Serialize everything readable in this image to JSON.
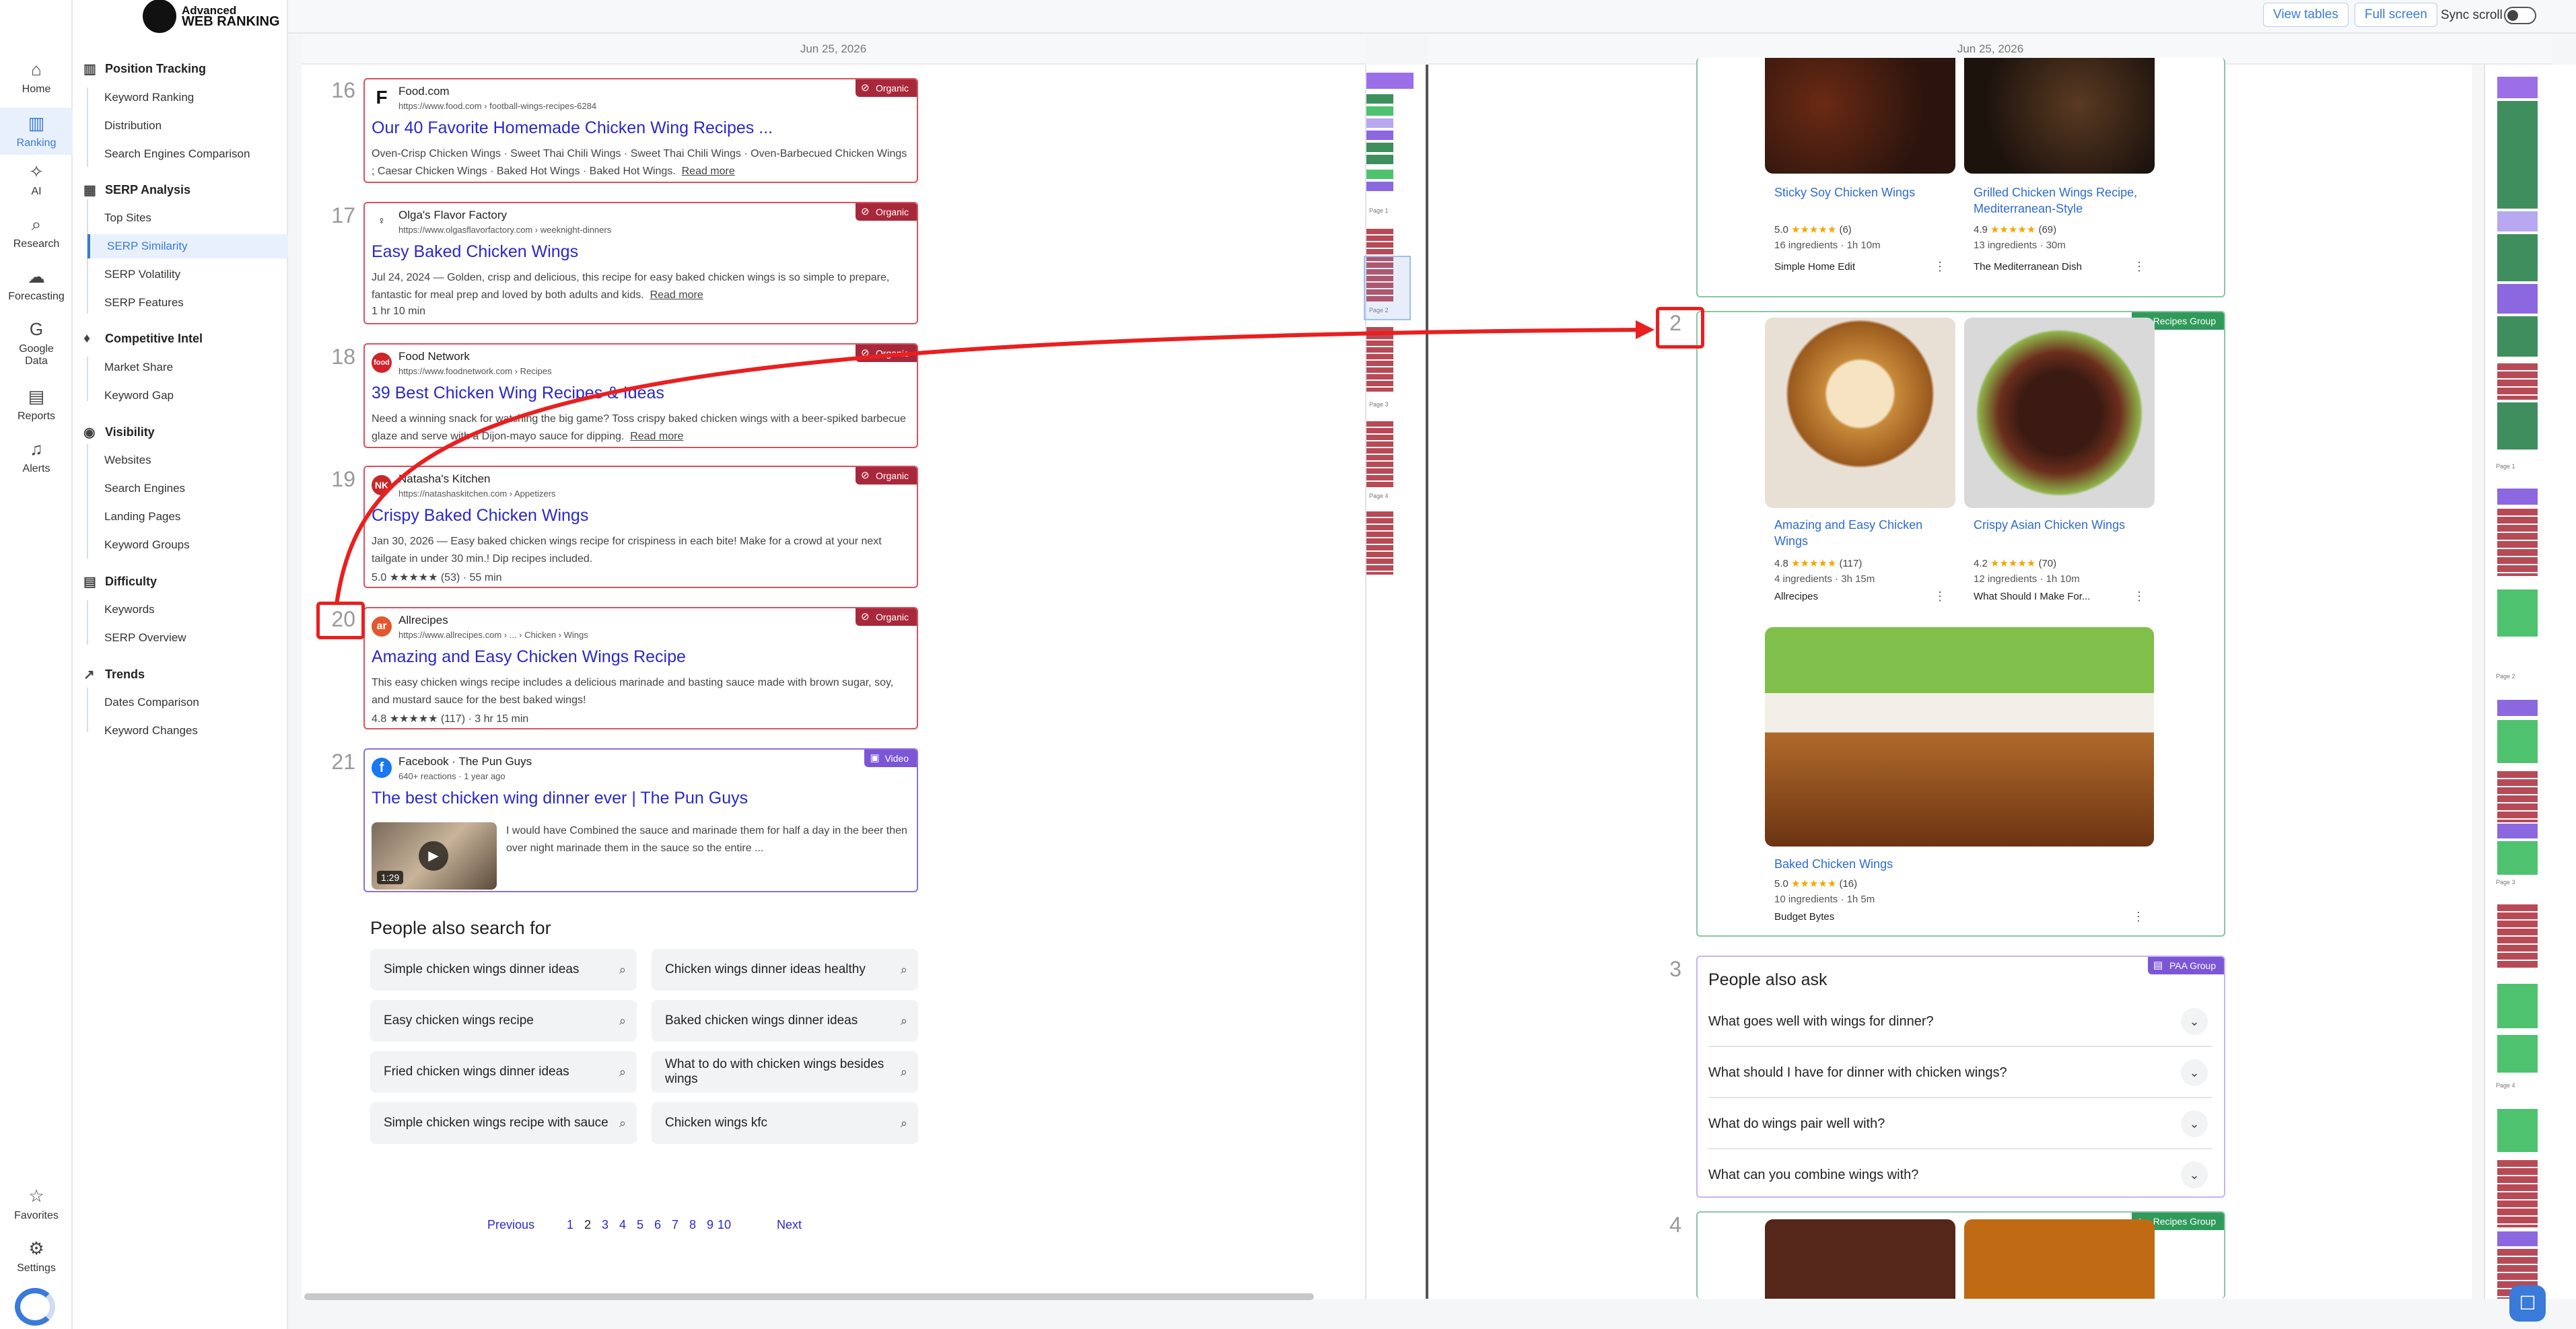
{
  "app": {
    "logo_top": "Advanced",
    "logo_bottom": "WEB RANKING"
  },
  "rail": [
    {
      "label": "Home",
      "icon": "home-icon",
      "glyph": "⌂"
    },
    {
      "label": "Ranking",
      "icon": "bar-chart-icon",
      "glyph": "▥"
    },
    {
      "label": "AI",
      "icon": "sparkle-icon",
      "glyph": "✧"
    },
    {
      "label": "Research",
      "icon": "magnifier-icon",
      "glyph": "⌕"
    },
    {
      "label": "Forecasting",
      "icon": "forecast-icon",
      "glyph": "☁"
    },
    {
      "label": "Google Data",
      "icon": "google-icon",
      "glyph": "G"
    },
    {
      "label": "Reports",
      "icon": "report-icon",
      "glyph": "▤"
    },
    {
      "label": "Alerts",
      "icon": "bell-icon",
      "glyph": "♫"
    },
    {
      "label": "Favorites",
      "icon": "star-icon",
      "glyph": "☆"
    },
    {
      "label": "Settings",
      "icon": "gear-icon",
      "glyph": "⚙"
    }
  ],
  "nav": {
    "sections": [
      {
        "title": "Position Tracking",
        "items": [
          "Keyword Ranking",
          "Distribution",
          "Search Engines Comparison"
        ]
      },
      {
        "title": "SERP Analysis",
        "items": [
          "Top Sites",
          "SERP Similarity",
          "SERP Volatility",
          "SERP Features"
        ]
      },
      {
        "title": "Competitive Intel",
        "items": [
          "Market Share",
          "Keyword Gap"
        ]
      },
      {
        "title": "Visibility",
        "items": [
          "Websites",
          "Search Engines",
          "Landing Pages",
          "Keyword Groups"
        ]
      },
      {
        "title": "Difficulty",
        "items": [
          "Keywords",
          "SERP Overview"
        ]
      },
      {
        "title": "Trends",
        "items": [
          "Dates Comparison",
          "Keyword Changes"
        ]
      }
    ]
  },
  "topbar": {
    "view_tables": "View tables",
    "full_screen": "Full screen",
    "sync_scroll": "Sync scroll"
  },
  "left": {
    "date": "Jun 25, 2026",
    "results": [
      {
        "rank": "16",
        "source": "Food.com",
        "url": "https://www.food.com › football-wings-recipes-6284",
        "title": "Our 40 Favorite Homemade Chicken Wing Recipes ...",
        "snippet": "Oven-Crisp Chicken Wings · Sweet Thai Chili Wings · Sweet Thai Chili Wings · Oven-Barbecued Chicken Wings ; Caesar Chicken Wings · Baked Hot Wings · Baked Hot Wings.",
        "read_more": "Read more",
        "meta": "",
        "badge": "Organic"
      },
      {
        "rank": "17",
        "source": "Olga's Flavor Factory",
        "url": "https://www.olgasflavorfactory.com › weeknight-dinners",
        "title": "Easy Baked Chicken Wings",
        "snippet": "Jul 24, 2024 — Golden, crisp and delicious, this recipe for easy baked chicken wings is so simple to prepare, fantastic for meal prep and loved by both adults and kids.",
        "read_more": "Read more",
        "meta": "1 hr 10 min",
        "badge": "Organic"
      },
      {
        "rank": "18",
        "source": "Food Network",
        "url": "https://www.foodnetwork.com › Recipes",
        "title": "39 Best Chicken Wing Recipes & Ideas",
        "snippet": "Need a winning snack for watching the big game? Toss crispy baked chicken wings with a beer-spiked barbecue glaze and serve with a Dijon-mayo sauce for dipping.",
        "read_more": "Read more",
        "meta": "",
        "badge": "Organic"
      },
      {
        "rank": "19",
        "source": "Natasha's Kitchen",
        "url": "https://natashaskitchen.com › Appetizers",
        "title": "Crispy Baked Chicken Wings",
        "snippet": "Jan 30, 2026 — Easy baked chicken wings recipe for crispiness in each bite! Make for a crowd at your next tailgate in under 30 min.! Dip recipes included.",
        "read_more": "",
        "meta": "5.0 ★★★★★ (53) · 55 min",
        "badge": "Organic"
      },
      {
        "rank": "20",
        "source": "Allrecipes",
        "url": "https://www.allrecipes.com › ... › Chicken › Wings",
        "title": "Amazing and Easy Chicken Wings Recipe",
        "snippet": "This easy chicken wings recipe includes a delicious marinade and basting sauce made with brown sugar, soy, and mustard sauce for the best baked wings!",
        "read_more": "",
        "meta": "4.8 ★★★★★ (117) · 3 hr 15 min",
        "badge": "Organic"
      }
    ],
    "video": {
      "rank": "21",
      "source": "Facebook · The Pun Guys",
      "sub": "640+ reactions · 1 year ago",
      "title": "The best chicken wing dinner ever | The Pun Guys",
      "snippet": "I would have Combined the sauce and marinade them for half a day in the beer then over night marinade them in the sauce so the entire ...",
      "duration": "1:29",
      "badge": "Video"
    },
    "pas_title": "People also search for",
    "pas": [
      "Simple chicken wings dinner ideas",
      "Chicken wings dinner ideas healthy",
      "Easy chicken wings recipe",
      "Baked chicken wings dinner ideas",
      "Fried chicken wings dinner ideas",
      "What to do with chicken wings besides wings",
      "Simple chicken wings recipe with sauce",
      "Chicken wings kfc"
    ],
    "pager": {
      "previous": "Previous",
      "next": "Next",
      "pages": [
        "1",
        "2",
        "3",
        "4",
        "5",
        "6",
        "7",
        "8",
        "9",
        "10"
      ]
    },
    "minimap_labels": [
      "Page 1",
      "Page 2",
      "Page 3",
      "Page 4"
    ]
  },
  "right": {
    "date": "Jun 25, 2026",
    "top_recipes": [
      {
        "name": "Sticky Soy Chicken Wings",
        "rating": "5.0",
        "count": "(6)",
        "meta": "16 ingredients · 1h 10m",
        "source": "Simple Home Edit"
      },
      {
        "name": "Grilled Chicken Wings Recipe, Mediterranean-Style",
        "rating": "4.9",
        "count": "(69)",
        "meta": "13 ingredients · 30m",
        "source": "The Mediterranean Dish"
      }
    ],
    "group2": {
      "rank": "2",
      "badge": "Recipes Group",
      "recipes": [
        {
          "name": "Amazing and Easy Chicken Wings",
          "rating": "4.8",
          "count": "(117)",
          "meta": "4 ingredients · 3h 15m",
          "source": "Allrecipes"
        },
        {
          "name": "Crispy Asian Chicken Wings",
          "rating": "4.2",
          "count": "(70)",
          "meta": "12 ingredients · 1h 10m",
          "source": "What Should I Make For..."
        },
        {
          "name": "Baked Chicken Wings",
          "rating": "5.0",
          "count": "(16)",
          "meta": "10 ingredients · 1h 5m",
          "source": "Budget Bytes"
        }
      ]
    },
    "paa": {
      "rank": "3",
      "badge": "PAA Group",
      "title": "People also ask",
      "questions": [
        "What goes well with wings for dinner?",
        "What should I have for dinner with chicken wings?",
        "What do wings pair well with?",
        "What can you combine wings with?"
      ]
    },
    "group4": {
      "rank": "4",
      "badge": "Recipes Group"
    },
    "minimap_labels": [
      "Page 1",
      "Page 2",
      "Page 3",
      "Page 4"
    ]
  },
  "colors": {
    "accent": "#3a7ad8",
    "organic": "#a8283b",
    "video": "#7b57d6",
    "recipes_group": "#2f9a5a",
    "highlight": "#ea1f1f"
  }
}
